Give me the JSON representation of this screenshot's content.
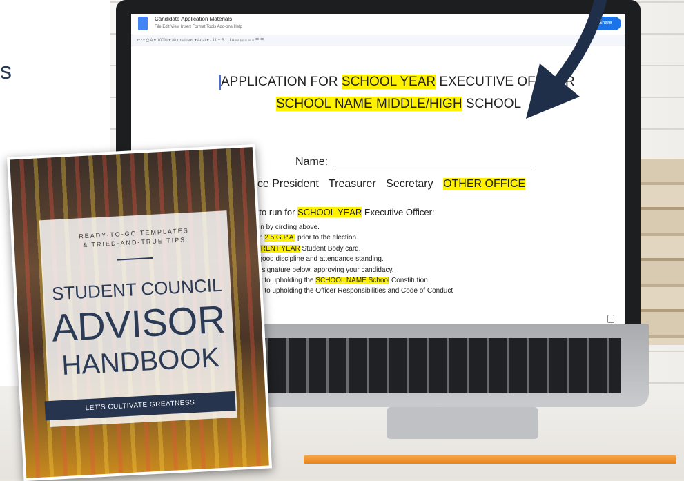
{
  "background": {
    "partial_text": "s"
  },
  "document": {
    "title": "Candidate Application Materials",
    "menu": "File  Edit  View  Insert  Format  Tools  Add-ons  Help",
    "share_label": "Share",
    "toolbar_text": "↶ ↷ ⎙ A  ▾  100%  ▾  Normal text  ▾  Arial  ▾  -  11  +   B  I  U  A   ⊕  ⊞  ≡  ≡  ≡  ☰  ☰",
    "heading_line1": {
      "pre": "APPLICATION FOR ",
      "hl": "SCHOOL YEAR",
      "post": " EXECUTIVE OFFICER"
    },
    "heading_line2": {
      "hl": "SCHOOL NAME MIDDLE/HIGH",
      "post": " SCHOOL"
    },
    "name_label": "Name:",
    "offices": [
      "t",
      "Vice President",
      "Treasurer",
      "Secretary"
    ],
    "other_office": "OTHER OFFICE",
    "requirements_head": {
      "pre": "nents to run for ",
      "hl": "SCHOOL YEAR",
      "post": " Executive Officer:"
    },
    "requirements": [
      {
        "pre": "e position by circling above.",
        "hl": "",
        "post": ""
      },
      {
        "pre": " minimum ",
        "hl": "2.5 G.P.A.",
        "post": " prior to the election."
      },
      {
        "pre": "s a ",
        "hl": "CURRENT YEAR",
        "post": " Student Body card."
      },
      {
        "pre": "ly be in good discipline and attendance standing.",
        "hl": "",
        "post": ""
      },
      {
        "pre": "a parent signature below, approving your candidacy.",
        "hl": "",
        "post": ""
      },
      {
        "pre": "d commit to upholding the ",
        "hl": "SCHOOL NAME School",
        "post": " Constitution."
      },
      {
        "pre": "d commit to upholding the Officer Responsibilities and Code of Conduct",
        "hl": "",
        "post": ""
      }
    ]
  },
  "cover": {
    "tagline_1": "READY-TO-GO TEMPLATES",
    "tagline_2": "& TRIED-AND-TRUE TIPS",
    "title_1": "STUDENT COUNCIL",
    "title_2": "ADVISOR",
    "title_3": "HANDBOOK",
    "banner": "LET'S CULTIVATE GREATNESS"
  },
  "colors": {
    "highlight": "#fff200",
    "navy": "#26344d",
    "docs_blue": "#1a73e8"
  }
}
